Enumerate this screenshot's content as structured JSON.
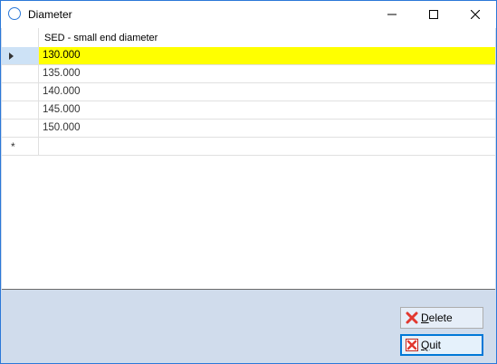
{
  "window": {
    "title": "Diameter"
  },
  "grid": {
    "column_header": "SED - small end diameter",
    "rows": [
      "130.000",
      "135.000",
      "140.000",
      "145.000",
      "150.000"
    ],
    "new_row_marker": "*",
    "selected_row_color": "#ffff00"
  },
  "buttons": {
    "delete_label_first": "D",
    "delete_label_rest": "elete",
    "quit_label_first": "Q",
    "quit_label_rest": "uit"
  },
  "icons": {
    "window": "circle-icon",
    "current_row": "row-pointer-icon",
    "new_row": "asterisk-icon",
    "delete": "red-x-icon",
    "quit": "red-x-box-icon"
  }
}
